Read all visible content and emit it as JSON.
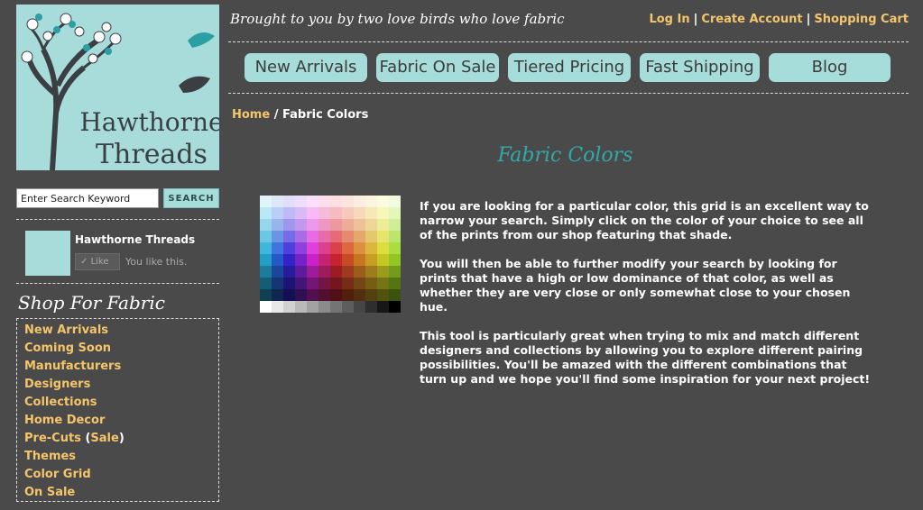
{
  "logo": {
    "line1": "Hawthorne",
    "line2": "Threads",
    "bg": "#a7dcda"
  },
  "header": {
    "tagline": "Brought to you by two love birds who love fabric",
    "links": [
      "Log In",
      "Create Account",
      "Shopping Cart"
    ],
    "nav": [
      "New Arrivals",
      "Fabric On Sale",
      "Tiered Pricing",
      "Fast Shipping",
      "Blog"
    ]
  },
  "search": {
    "placeholder": "Enter Search Keyword",
    "button": "SEARCH"
  },
  "facebook": {
    "page_name": "Hawthorne Threads",
    "like_label": "Like",
    "like_text": "You like this."
  },
  "shop": {
    "title": "Shop For Fabric",
    "items": [
      "New Arrivals",
      "Coming Soon",
      "Manufacturers",
      "Designers",
      "Collections",
      "Home Decor",
      "Pre-Cuts",
      "Themes",
      "Color Grid",
      "On Sale"
    ],
    "precuts_sale": "Sale"
  },
  "breadcrumb": {
    "home": "Home",
    "current": "Fabric Colors",
    "separator": "/"
  },
  "main": {
    "title": "Fabric Colors",
    "paragraphs": [
      "If you are looking for a particular color, this grid is an excellent way to narrow your search. Simply click on the color of your choice to see all of the prints from our shop featuring that shade.",
      "You will then be able to further modify your search by looking for prints that have a high or low dominance of that color, as well as whether they are very close or only somewhat close to your chosen hue.",
      "This tool is particularly great when trying to mix and match different designers and collections by allowing you to explore different pairing possibilities. You'll be amazed with the different combinations that turn up and we hope you'll find some inspiration for your next project!"
    ]
  },
  "colors": {
    "accent": "#a6dcda",
    "link": "#f5c56b",
    "title": "#30a9a8",
    "background": "#4a4a4a"
  },
  "grid_hues": [
    195,
    220,
    245,
    270,
    300,
    330,
    355,
    15,
    30,
    45,
    60,
    80
  ]
}
